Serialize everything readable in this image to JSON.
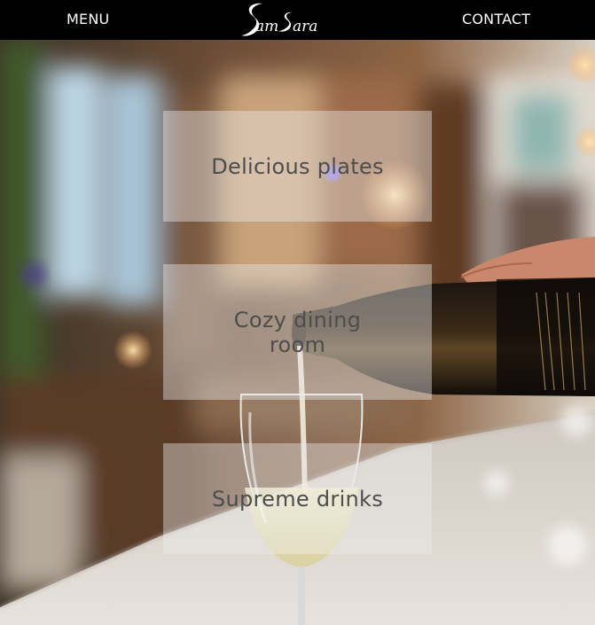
{
  "header": {
    "menu_label": "MENU",
    "contact_label": "CONTACT",
    "logo_text": "SamSara",
    "background": "#000000"
  },
  "hero": {
    "image_description_icon": "restaurant-wine-pour-photo"
  },
  "cards": [
    {
      "label": "Delicious plates"
    },
    {
      "label": "Cozy dining room"
    },
    {
      "label": "Supreme drinks"
    }
  ],
  "colors": {
    "nav_text": "#ffffff",
    "card_text": "#4d4d4d",
    "card_bg": "rgba(235,235,235,0.42)"
  }
}
